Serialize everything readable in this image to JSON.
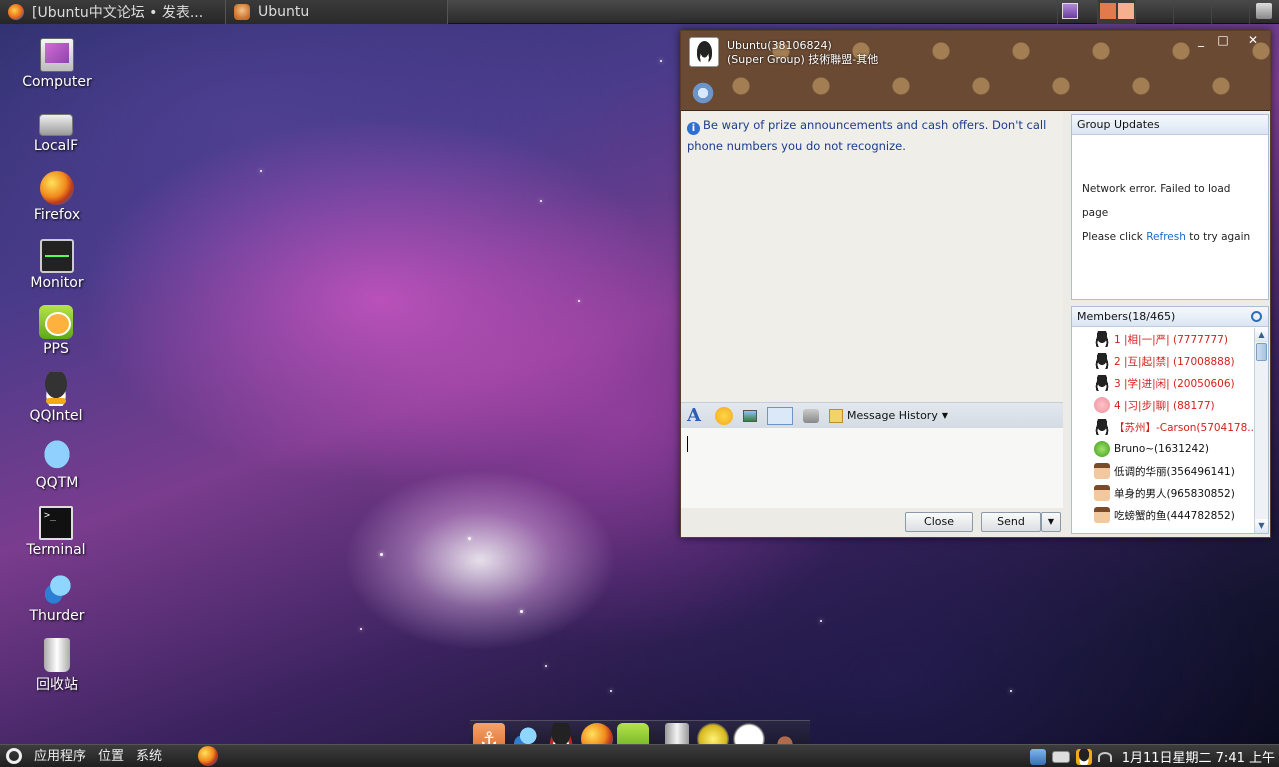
{
  "top_panel": {
    "tasks": [
      {
        "label": "[Ubuntu中文论坛 • 发表...",
        "icon": "firefox-icon"
      },
      {
        "label": "Ubuntu",
        "icon": "people-icon"
      }
    ]
  },
  "desktop_icons": [
    {
      "label": "Computer",
      "icon": "computer-icon"
    },
    {
      "label": "LocalF",
      "icon": "drive-icon"
    },
    {
      "label": "Firefox",
      "icon": "firefox-icon"
    },
    {
      "label": "Monitor",
      "icon": "system-monitor-icon"
    },
    {
      "label": "PPS",
      "icon": "pps-icon"
    },
    {
      "label": "QQIntel",
      "icon": "qq-icon"
    },
    {
      "label": "QQTM",
      "icon": "qqtm-icon"
    },
    {
      "label": "Terminal",
      "icon": "terminal-icon"
    },
    {
      "label": "Thurder",
      "icon": "thunder-icon"
    },
    {
      "label": "回收站",
      "icon": "trash-icon"
    }
  ],
  "terminal_glyph": ">_",
  "qq_window": {
    "title_line1": "Ubuntu(38106824)",
    "title_line2": "(Super Group) 技術聯盟-其他",
    "win_controls": {
      "minimize": "_",
      "maximize": "□",
      "close": "✕"
    },
    "warning": "Be wary of prize announcements and cash offers. Don't call phone numbers you do not recognize.",
    "info_glyph": "i",
    "font_glyph": "A",
    "message_history": "Message History",
    "close_label": "Close",
    "send_label": "Send",
    "group_updates": {
      "title": "Group Updates",
      "line1": "Network error. Failed to load page",
      "line2_prefix": "Please click ",
      "line2_link": "Refresh",
      "line2_suffix": " to try again"
    },
    "members": {
      "title": "Members(18/465)",
      "items": [
        {
          "text": "1 |相|一|严|    (7777777)",
          "color": "#d4201c",
          "avatar": "penguin"
        },
        {
          "text": "2 |互|起|禁|    (17008888)",
          "color": "#d4201c",
          "avatar": "penguin"
        },
        {
          "text": "3 |学|进|闲|  (20050606)",
          "color": "#d4201c",
          "avatar": "penguin"
        },
        {
          "text": "4 |习|步|聊|    (88177)",
          "color": "#d4201c",
          "avatar": "pig"
        },
        {
          "text": "【苏州】-Carson(5704178...",
          "color": "#d4201c",
          "avatar": "penguin"
        },
        {
          "text": "Bruno~(1631242)",
          "color": "#111111",
          "avatar": "frog"
        },
        {
          "text": "低调的华丽(356496141)",
          "color": "#111111",
          "avatar": "person"
        },
        {
          "text": "单身的男人(965830852)",
          "color": "#111111",
          "avatar": "person"
        },
        {
          "text": "吃螃蟹的鱼(444782852)",
          "color": "#111111",
          "avatar": "person"
        }
      ]
    }
  },
  "dock": [
    "anchor-icon",
    "thunder-icon",
    "qq-icon",
    "firefox-icon",
    "pps-icon",
    "trash-icon",
    "moon-icon",
    "clock-icon",
    "paw-icon"
  ],
  "bottom_panel": {
    "menus": [
      "应用程序",
      "位置",
      "系统"
    ],
    "clock": "1月11日星期二  7:41 上午"
  },
  "colors": {
    "accent_link": "#1a6cc8",
    "warning_text": "#1d3c8c",
    "member_highlight": "#d4201c"
  }
}
